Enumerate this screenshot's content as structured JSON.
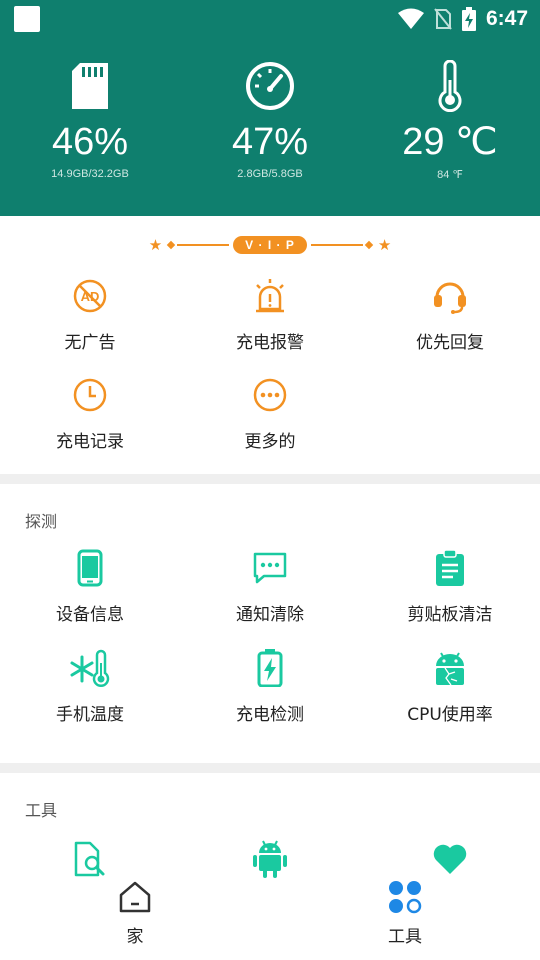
{
  "status_bar": {
    "time": "6:47"
  },
  "stats": [
    {
      "name": "storage",
      "value": "46%",
      "sub": "14.9GB/32.2GB",
      "icon": "sd-card-icon"
    },
    {
      "name": "memory",
      "value": "47%",
      "sub": "2.8GB/5.8GB",
      "icon": "speedometer-icon"
    },
    {
      "name": "temperature",
      "value": "29 ℃",
      "sub": "84 ℉",
      "icon": "thermometer-icon"
    }
  ],
  "vip": {
    "badge": "V · I · P",
    "items": [
      {
        "label": "无广告",
        "icon": "no-ads-icon"
      },
      {
        "label": "充电报警",
        "icon": "alarm-icon"
      },
      {
        "label": "优先回复",
        "icon": "headset-icon"
      },
      {
        "label": "充电记录",
        "icon": "clock-icon"
      },
      {
        "label": "更多的",
        "icon": "more-icon"
      }
    ]
  },
  "detect": {
    "title": "探测",
    "items": [
      {
        "label": "设备信息",
        "icon": "phone-icon"
      },
      {
        "label": "通知清除",
        "icon": "chat-icon"
      },
      {
        "label": "剪贴板清洁",
        "icon": "clipboard-icon"
      },
      {
        "label": "手机温度",
        "icon": "snow-thermometer-icon"
      },
      {
        "label": "充电检测",
        "icon": "battery-charging-icon"
      },
      {
        "label": "CPU使用率",
        "icon": "android-cracked-icon"
      }
    ]
  },
  "tools": {
    "title": "工具",
    "items": [
      {
        "icon": "file-search-icon"
      },
      {
        "icon": "android-icon"
      },
      {
        "icon": "heart-icon"
      }
    ]
  },
  "bottom_nav": {
    "home_label": "家",
    "tools_label": "工具"
  },
  "colors": {
    "header": "#0f7f6e",
    "vip_orange": "#f29122",
    "teal_icon": "#1ac9a0",
    "nav_blue": "#1e88e5"
  }
}
